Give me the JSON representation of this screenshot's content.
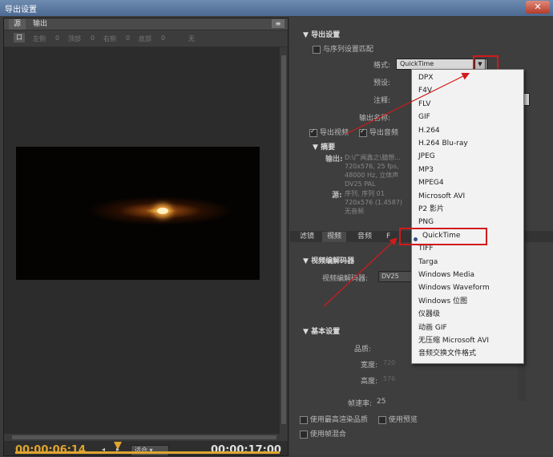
{
  "window": {
    "title": "导出设置",
    "close_label": "✕"
  },
  "left": {
    "tabs": [
      "源",
      "输出"
    ],
    "panel_menu": "≡",
    "crop": {
      "icon_label": "口",
      "left": "左侧",
      "left_val": "0",
      "top": "顶部",
      "top_val": "0",
      "right": "右侧",
      "right_val": "0",
      "bottom": "底部",
      "bottom_val": "0",
      "ratio": "无"
    },
    "timecode_current": "00:00:06:14",
    "timecode_total": "00:00:17:00",
    "fit_label": "适合",
    "mark_in": "◂",
    "mark_out": "▸"
  },
  "export": {
    "section_title": "导出设置",
    "match_sequence": "与序列设置匹配",
    "format_label": "格式:",
    "format_value": "QuickTime",
    "preset_label": "预设:",
    "comment_label": "注释:",
    "output_name_label": "输出名称:",
    "export_video": "导出视频",
    "export_audio": "导出音频",
    "summary_title": "摘要",
    "output_label": "输出:",
    "output_lines": [
      "D:\\广闻鑫之\\臆想...",
      "720x576, 25 fps,",
      "48000 Hz, 立体声",
      "DV25 PAL"
    ],
    "source_label": "源:",
    "source_lines": [
      "序列, 序列 01",
      "720x576 (1.4587)",
      "无音频"
    ]
  },
  "sub_tabs": [
    "滤镜",
    "视频",
    "音频",
    "F"
  ],
  "video_codec": {
    "section_title": "视频编解码器",
    "label": "视频编解码器:",
    "value": "DV25"
  },
  "basic": {
    "section_title": "基本设置",
    "quality": "品质:",
    "width": "宽度:",
    "width_val": "720",
    "height": "高度:",
    "height_val": "576",
    "frame_rate": "帧速率:",
    "frame_rate_val": "25"
  },
  "bottom": {
    "max_render": "使用最高渲染品质",
    "use_preview": "使用预览",
    "frame_blend": "使用帧混合"
  },
  "dropdown": {
    "selected": "QuickTime",
    "items": [
      "DPX",
      "F4V",
      "FLV",
      "GIF",
      "H.264",
      "H.264 Blu-ray",
      "JPEG",
      "MP3",
      "MPEG4",
      "Microsoft AVI",
      "P2 影片",
      "PNG",
      "QuickTime",
      "TIFF",
      "Targa",
      "Windows Media",
      "Windows Waveform",
      "Windows 位图",
      "仪器级",
      "动画 GIF",
      "无压缩 Microsoft AVI",
      "音频交换文件格式"
    ]
  },
  "colors": {
    "timecode": "#e0a530",
    "highlight_red": "#d21a1a"
  }
}
